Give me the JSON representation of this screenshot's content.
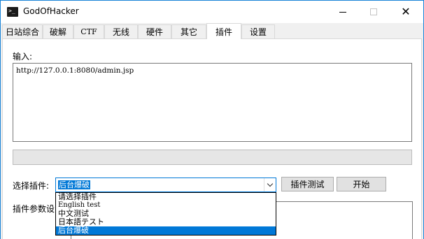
{
  "window": {
    "title": "GodOfHacker",
    "icon": "terminal-icon",
    "icon_glyph": ">_",
    "controls": {
      "minimize": "minimize-icon",
      "maximize": "maximize-icon",
      "close_glyph": "✕"
    }
  },
  "tabs": [
    {
      "label": "日站综合",
      "active": false
    },
    {
      "label": "破解",
      "active": false
    },
    {
      "label": "CTF",
      "active": false
    },
    {
      "label": "无线",
      "active": false
    },
    {
      "label": "硬件",
      "active": false
    },
    {
      "label": "其它",
      "active": false
    },
    {
      "label": "插件",
      "active": true
    },
    {
      "label": "设置",
      "active": false
    }
  ],
  "plugin_panel": {
    "input_label": "输入:",
    "input_value": "http://127.0.0.1:8080/admin.jsp",
    "progress": 0,
    "select_label": "选择插件:",
    "selected_plugin": "后台爆破",
    "test_button": "插件测试",
    "start_button": "开始",
    "params_label": "插件参数设",
    "dropdown_options": [
      "请选择插件",
      "English test",
      "中文测试",
      "日本語テスト",
      "后台爆破"
    ],
    "dropdown_selected_index": 4
  },
  "colors": {
    "accent": "#0078d7",
    "window_border": "#1883d7",
    "button_bg": "#e1e1e1"
  }
}
